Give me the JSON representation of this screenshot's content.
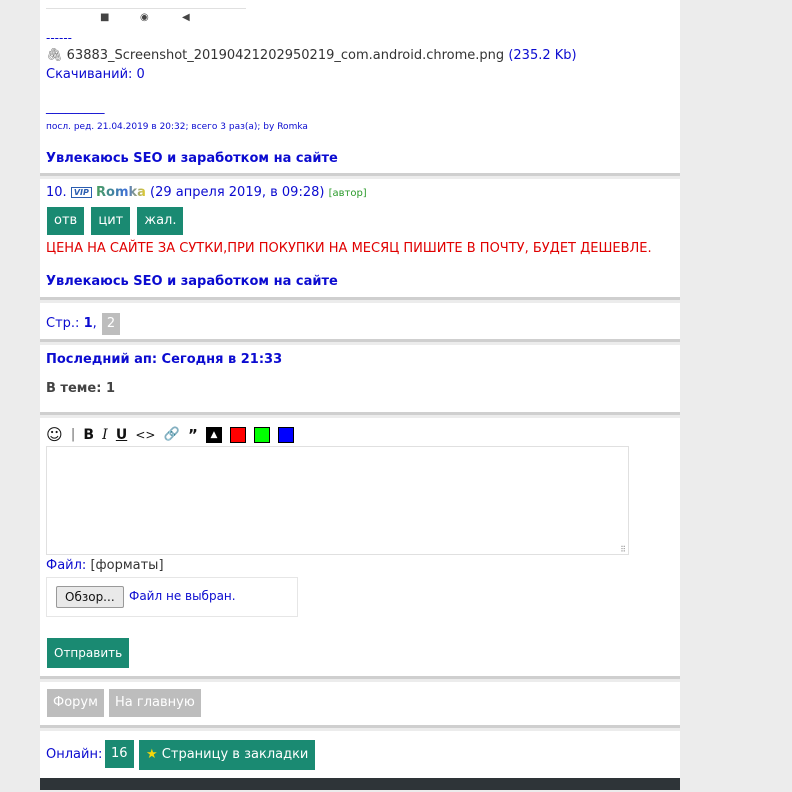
{
  "top": {
    "separator": "------",
    "attachment_name": "63883_Screenshot_20190421202950219_com.android.chrome.png",
    "attachment_size": "(235.2 Kb)",
    "downloads": "Скачиваний: 0",
    "edit_line": "_________",
    "edit_note": "посл. ред. 21.04.2019 в 20:32; всего 3 раз(а); by Romka",
    "signature": "Увлекаюсь SEO и заработком на сайте"
  },
  "post": {
    "number": "10.",
    "vip_badge": "VIP",
    "user": "Romka",
    "date": "(29 апреля 2019, в 09:28)",
    "author_tag": "[автор]",
    "actions": [
      "отв",
      "цит",
      "жал."
    ],
    "message": "ЦЕНА НА САЙТЕ ЗА СУТКИ,ПРИ ПОКУПКИ НА МЕСЯЦ ПИШИТЕ В ПОЧТУ, БУДЕТ ДЕШЕВЛЕ.",
    "signature": "Увлекаюсь SEO и заработком на сайте"
  },
  "pagination": {
    "label": "Стр.:",
    "current": "1",
    "sep": ",",
    "next": "2"
  },
  "info": {
    "last_update": "Последний ап: Сегодня в 21:33",
    "in_topic": "В теме: 1"
  },
  "editor": {
    "file_label": "Файл:",
    "formats": "[форматы]",
    "browse": "Обзор...",
    "no_file": "Файл не выбран.",
    "submit": "Отправить",
    "colors": {
      "red": "#ff0000",
      "green": "#00ff00",
      "blue": "#0000ff",
      "black": "#000000"
    }
  },
  "nav": {
    "forum": "Форум",
    "home": "На главную"
  },
  "footer": {
    "online_label": "Онлайн:",
    "online_count": "16",
    "bookmark": "Страницу в закладки"
  }
}
